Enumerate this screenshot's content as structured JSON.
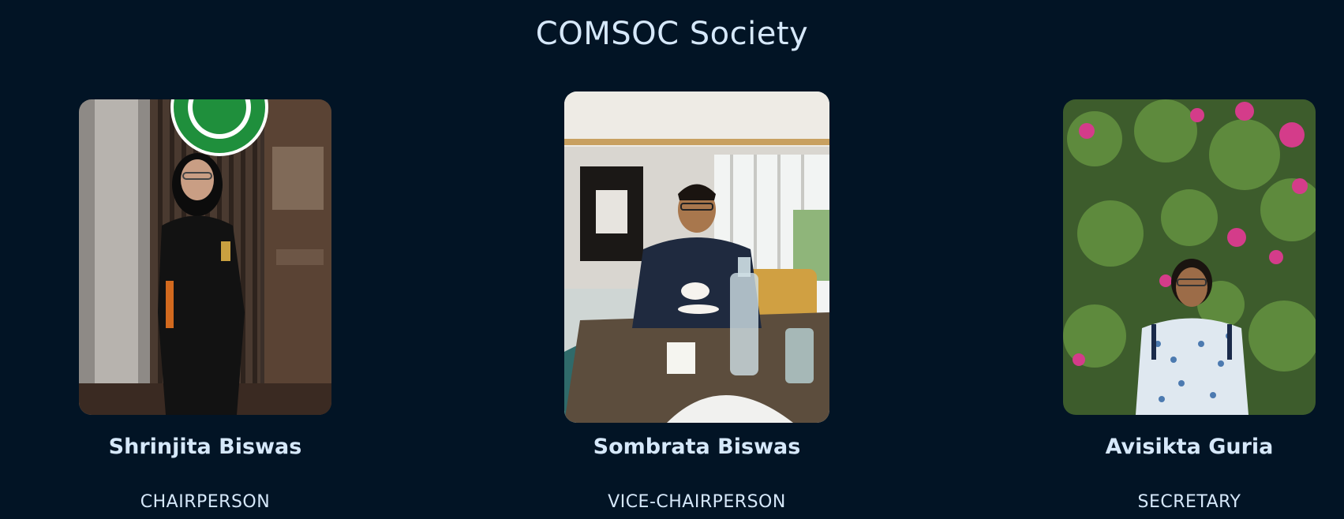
{
  "page": {
    "title": "COMSOC Society"
  },
  "members": [
    {
      "name": "Shrinjita Biswas",
      "role": "CHAIRPERSON",
      "photo": "member-photo-cafe"
    },
    {
      "name": "Sombrata Biswas",
      "role": "VICE-CHAIRPERSON",
      "photo": "member-photo-restaurant"
    },
    {
      "name": "Avisikta Guria",
      "role": "SECRETARY",
      "photo": "member-photo-garden"
    }
  ],
  "colors": {
    "background": "#021425",
    "text": "#d6e8fa"
  }
}
